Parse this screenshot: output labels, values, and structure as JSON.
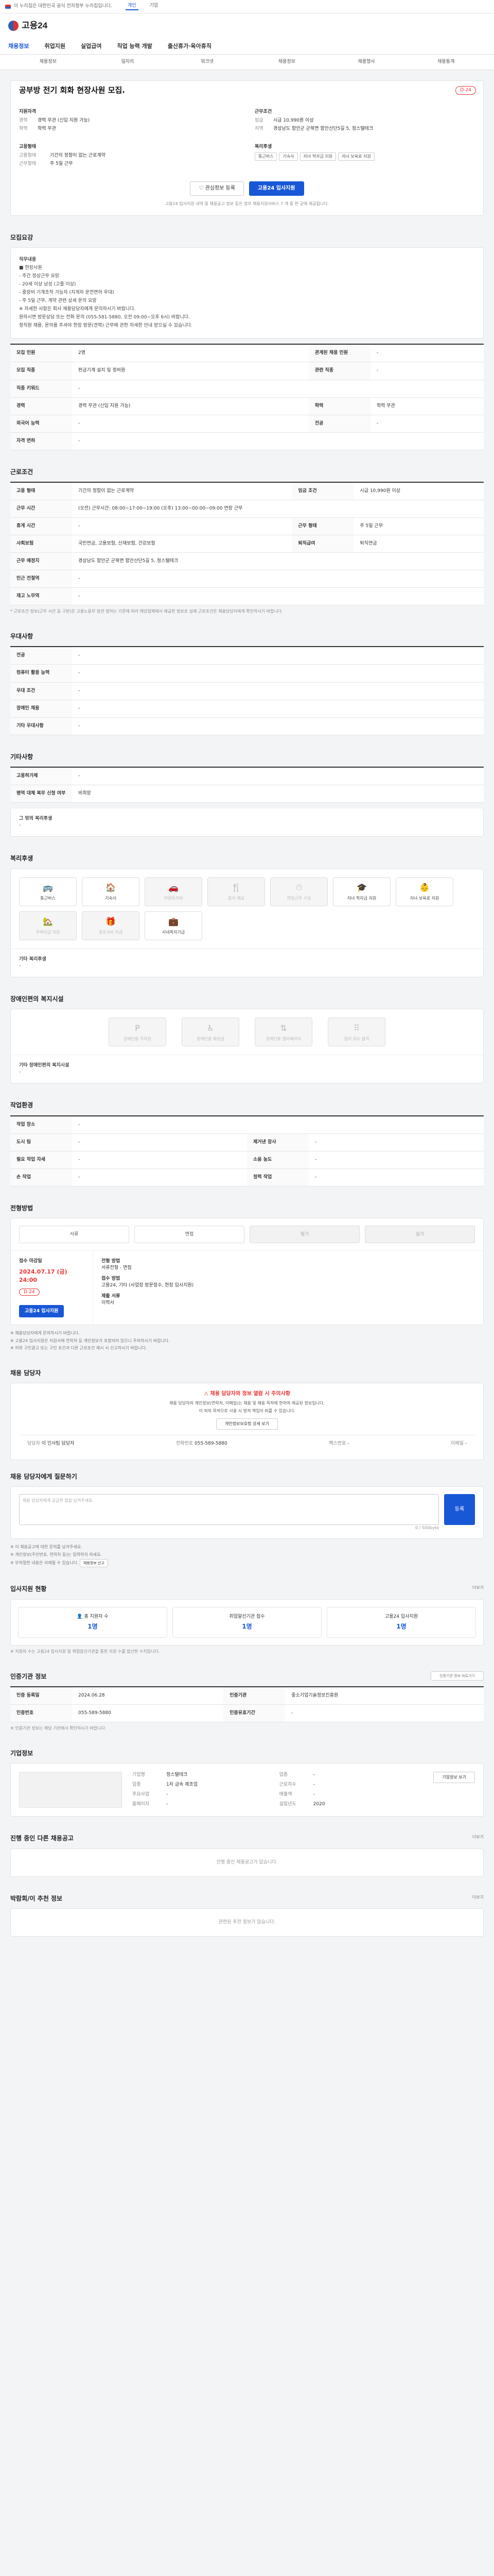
{
  "top": {
    "gov_text": "이 누리집은 대한민국 공식 전자정부 누리집입니다.",
    "nav": [
      "개인",
      "기업"
    ]
  },
  "header": {
    "logo": "고용24"
  },
  "gnb": [
    "채용정보",
    "취업지원",
    "실업급여",
    "직업 능력 개발",
    "출산휴가·육아휴직"
  ],
  "subnav": [
    "채용정보",
    "일자리",
    "워크넷",
    "채용정보",
    "채용행사",
    "채용통계"
  ],
  "summary": {
    "title": "공부방 전기 회화 현장사원 모집.",
    "dday": "D-24",
    "left_label": "지원자격",
    "left": [
      {
        "k": "경력",
        "v": "경력 무관 (신입 지원 가능)"
      },
      {
        "k": "학력",
        "v": "학력 무관"
      }
    ],
    "right_label": "근무조건",
    "right": [
      {
        "k": "임금",
        "v": "시급 10,990원 이상"
      },
      {
        "k": "지역",
        "v": "경상남도 함안군 군북면 함안산단5길 5, 정스텔테크"
      }
    ],
    "type_label": "고용형태",
    "type": [
      {
        "k": "고용형태",
        "v": "기간의 정함이 없는 근로계약"
      },
      {
        "k": "근무형태",
        "v": "주 5일 근무"
      }
    ],
    "welfare_label": "복리후생",
    "welfare": [
      "통근버스",
      "기숙사",
      "자녀 학자금 지원",
      "자녀 보육료 지원"
    ]
  },
  "buttons": {
    "scrap": "관심정보 등록",
    "apply": "고용24 입사지원"
  },
  "notice": "고용24 입사지원 내역 및 채용공고 정보 등은 정부 채용지원서비스 7 개 중 한 곳에 제공됩니다.",
  "sections": {
    "job": "모집요강",
    "cond": "근로조건",
    "pref": "우대사항",
    "apply_way": "기타사항",
    "welfare": "복리후생",
    "disability": "장애인편의 복지시설",
    "place": "작업환경",
    "process": "전형방법",
    "manager": "채용 담당자",
    "qna": "채용 담당자에게 질문하기",
    "status": "입사지원 현황",
    "authinfo": "인증기관 정보",
    "company": "기업정보",
    "same": "진행 중인 다른 채용공고",
    "related": "박람회/이 추천 정보"
  },
  "job": {
    "h": "직무내용",
    "lines": [
      "■ 현장사원",
      "- 주간 정상근무 요망",
      "- 20세 이상 남성 (고졸 이상)",
      "- 중장비 기계조작 가능자 (지게차 운전면허 우대)",
      "- 주 5일 근무, 계약 관련 상세 문의 요망",
      "※ 자세한 사항은 회사 채용담당자에게 문의하시기 바랍니다.",
      "원하시면 방문상담 또는 전화 문의 (055-581-5880, 오전 09:00~오후 6시) 바랍니다.",
      "정직원 채용, 문의를 주셔야 현장 방문(견학) 근무에 관한 자세한 안내 받으실 수 있습니다."
    ],
    "rows": [
      [
        "모집 인원",
        "2명",
        "관계된 채용 인원",
        "-"
      ],
      [
        "모집 직종",
        "판금기계 설치 및 정비원",
        "관련 직종",
        "-"
      ],
      [
        "직종 키워드",
        "-",
        "",
        ""
      ],
      [
        "경력",
        "경력 무관 (신입 지원 가능)",
        "학력",
        "학력 무관"
      ],
      [
        "외국어 능력",
        "-",
        "전공",
        "-"
      ],
      [
        "자격 면허",
        "-",
        "",
        ""
      ]
    ]
  },
  "cond": {
    "rows": [
      [
        "고용 형태",
        "기간의 정함이 없는 근로계약",
        "임금 조건",
        "시급 10,990원 이상"
      ],
      [
        "근무 시간",
        "(오전) 근무시간: 08:00~17:00~19:00 (오후) 13:00~00:00~09:00 연장 근무",
        "",
        ""
      ],
      [
        "휴게 시간",
        "-",
        "근무 형태",
        "주 5일 근무"
      ],
      [
        "사회보험",
        "국민연금, 고용보험, 산재보험, 건강보험",
        "퇴직급여",
        "퇴직연금"
      ],
      [
        "근무 예정지",
        "경상남도 함안군 군북면 함안산단5길 5, 정스텔테크",
        "",
        ""
      ],
      [
        "인근 전철역",
        "-",
        "",
        ""
      ],
      [
        "재고 노무역",
        "-",
        "",
        ""
      ]
    ],
    "note": "* 근로조건 정보(근무 시간 등 구분)은 고용노동부 장관 정하는 기준에 따라 해당업체에서 제공한 정보로 실제 근로조건은 채용담당자에게 확인하시기 바랍니다."
  },
  "pref": {
    "rows": [
      [
        "전공",
        "-"
      ],
      [
        "컴퓨터 활용 능력",
        "-"
      ],
      [
        "우대 조건",
        "-"
      ],
      [
        "장애인 채용",
        "-"
      ],
      [
        "기타 우대사항",
        "-"
      ]
    ]
  },
  "apply_way": {
    "rows": [
      [
        "고용허가제",
        "-"
      ],
      [
        "병역 대체 복무 신청 여부",
        "비희망"
      ]
    ],
    "extra_label": "그 밖의 복리후생",
    "extra": "-"
  },
  "welfare": {
    "items": [
      {
        "n": "통근버스",
        "ic": "🚌",
        "d": false
      },
      {
        "n": "기숙사",
        "ic": "🏠",
        "d": false
      },
      {
        "n": "차량유지비",
        "ic": "🚗",
        "d": true
      },
      {
        "n": "중식 제공",
        "ic": "🍴",
        "d": true
      },
      {
        "n": "연장근무 수당",
        "ic": "⏱",
        "d": true
      },
      {
        "n": "자녀 학자금 지원",
        "ic": "🎓",
        "d": false
      },
      {
        "n": "자녀 보육료 지원",
        "ic": "👶",
        "d": false
      },
      {
        "n": "주택자금 지원",
        "ic": "🏡",
        "d": true
      },
      {
        "n": "경조사비 지급",
        "ic": "🎁",
        "d": true
      },
      {
        "n": "사내복지기금",
        "ic": "💼",
        "d": false
      }
    ],
    "extra_label": "기타 복리후생",
    "extra": "-"
  },
  "disability": {
    "items": [
      "장애인용 주차장",
      "장애인용 화장실",
      "장애인용 엘리베이터",
      "점자 유도 블럭"
    ],
    "extra_label": "기타 장애인편의 복지시설",
    "extra": "-"
  },
  "place": {
    "rows": [
      [
        "작업 장소",
        "-",
        "",
        ""
      ],
      [
        "도시 팀",
        "-",
        "제거낸 장사",
        "-"
      ],
      [
        "필요 작업 자세",
        "-",
        "소음 농도",
        "-"
      ],
      [
        "손 작업",
        "-",
        "청력 작업",
        "-"
      ]
    ]
  },
  "process": {
    "steps": [
      "서류",
      "면접",
      "필기",
      "실기"
    ],
    "deadline_label": "접수 마감일",
    "deadline": "2024.07.17 (금) 24:00",
    "dday": "D-24",
    "method_label": "전형 방법",
    "method": "서류전형 - 면접",
    "apply_label": "접수 방법",
    "apply": "고용24, 기타 (사업장 방문접수, 현장 입사지원)",
    "fee_label": "제출 서류",
    "fee": "이력서",
    "bullets": [
      "※ 채용담당자에게 문의하시기 바랍니다.",
      "※ 고용24 입사지원은 지원서에 연락처 등 개인정보가 포함되어 있으니 주의하시기 바랍니다.",
      "※ 허위 구인광고 또는 구인 조건과 다른 근로조건 제시 시 신고하시기 바랍니다."
    ]
  },
  "manager": {
    "warn": "채용 담당자와 정보 열람 시 주의사항",
    "sub": "채용 담당자의 개인정보(연락처, 이메일)는 채용 및 채용 목적에 한하여 제공된 정보입니다.",
    "sub2": "이 외의 목적으로 사용 시 법적 책임이 따를 수 있습니다.",
    "btn": "개인정보보호법 상세 보기",
    "name_label": "담당자",
    "name": "이 인사팀 담당자",
    "phone_label": "전화번호",
    "phone": "055-589-5880",
    "fax_label": "팩스번호",
    "fax": "-",
    "email_label": "이메일",
    "email": "-"
  },
  "qna": {
    "placeholder": "채용 담당자에게 궁금한 점을 남겨주세요.",
    "send": "등록",
    "count": "0 / 500byte",
    "notes": [
      "※ 이 채용공고에 대한 문의를 남겨주세요.",
      "※ 개인정보(주민번호, 연락처 등)는 입력하지 마세요.",
      "※ 부적절한 내용은 삭제될 수 있습니다."
    ],
    "notice_btn": "채용정보 신고"
  },
  "status": {
    "items": [
      {
        "l": "총 지원자 수",
        "n": "1명"
      },
      {
        "l": "취업알선기관 접수",
        "n": "1명"
      },
      {
        "l": "고용24 입사지원",
        "n": "1명"
      }
    ],
    "note": "※ 지원자 수는 고용24 입사지원 및 취업알선기관을 통한 지원 수를 합산한 수치입니다.",
    "more": "더보기"
  },
  "authinfo": {
    "rows": [
      [
        "인증 등록일",
        "2024.06.28",
        "인증기관",
        "중소기업기술정보진흥원"
      ],
      [
        "인증번호",
        "055-589-5880",
        "인증유효기간",
        "-"
      ]
    ],
    "note": "※ 인증기관 정보는 해당 기관에서 확인하시기 바랍니다.",
    "btn": "인증기관 정보 바로가기"
  },
  "company": {
    "rows": [
      [
        "기업명",
        "정스텔테크",
        "업종",
        "-"
      ],
      [
        "업종",
        "1차 금속 제조업",
        "근로자수",
        "-"
      ],
      [
        "주요사업",
        "-",
        "매출액",
        "-"
      ],
      [
        "홈페이지",
        "-",
        "설립년도",
        "2020"
      ]
    ],
    "btn": "기업정보 보기"
  },
  "same": {
    "empty": "진행 중인 채용공고가 없습니다.",
    "more": "더보기"
  },
  "related": {
    "empty": "관련된 추천 정보가 없습니다.",
    "more": "더보기"
  }
}
